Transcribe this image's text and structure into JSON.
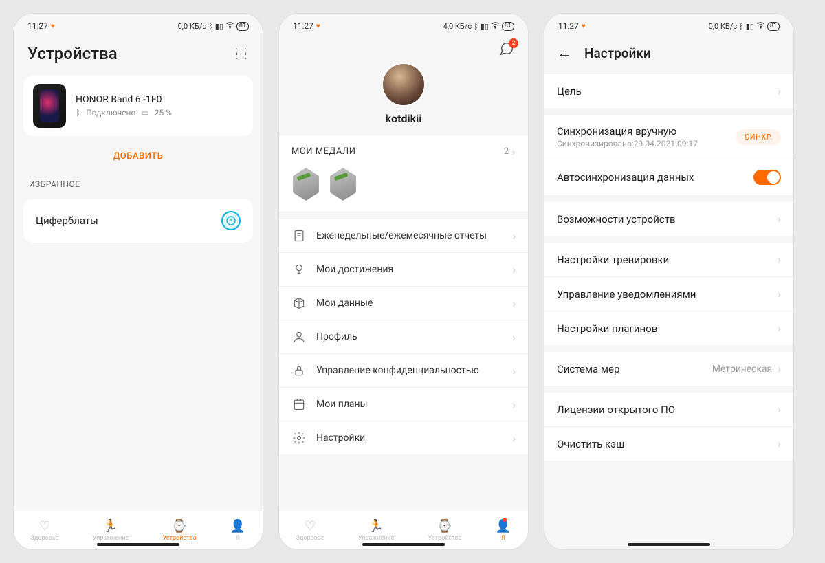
{
  "status": {
    "time": "11:27",
    "net1": "0,0 КБ/с",
    "net2": "4,0 КБ/с",
    "battery": "81"
  },
  "s1": {
    "title": "Устройства",
    "device": {
      "name": "HONOR Band 6 -1F0",
      "status": "Подключено",
      "battery": "25 %"
    },
    "add": "ДОБАВИТЬ",
    "favorites_label": "ИЗБРАННОЕ",
    "watchfaces": "Циферблаты",
    "nav": [
      "Здоровье",
      "Упражнение",
      "Устройства",
      "Я"
    ]
  },
  "s2": {
    "chat_badge": "2",
    "username": "kotdikii",
    "medals_label": "МОИ МЕДАЛИ",
    "medals_count": "2",
    "items": [
      "Еженедельные/ежемесячные отчеты",
      "Мои достижения",
      "Мои данные",
      "Профиль",
      "Управление конфиденциальностью",
      "Мои планы",
      "Настройки"
    ],
    "nav": [
      "Здоровье",
      "Упражнение",
      "Устройства",
      "Я"
    ]
  },
  "s3": {
    "title": "Настройки",
    "goal": "Цель",
    "sync_manual": "Синхронизация вручную",
    "sync_time": "Синхронизировано:29.04.2021 09:17",
    "sync_btn": "СИНХР.",
    "autosync": "Автосинхронизация данных",
    "device_caps": "Возможности устройств",
    "workout": "Настройки тренировки",
    "notif": "Управление уведомлениями",
    "plugins": "Настройки плагинов",
    "units": "Система мер",
    "units_val": "Метрическая",
    "licenses": "Лицензии открытого ПО",
    "clear_cache": "Очистить кэш"
  }
}
